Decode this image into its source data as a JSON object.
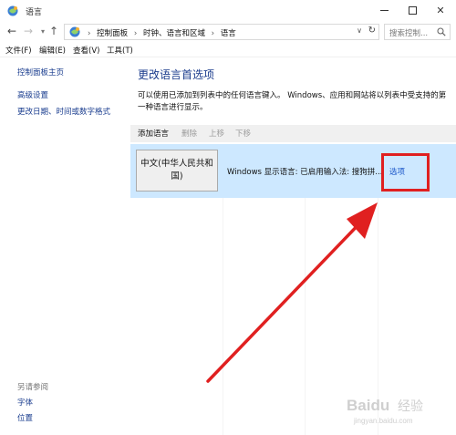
{
  "window": {
    "title": "语言",
    "minimize": "minimize",
    "maximize": "maximize",
    "close": "✕"
  },
  "address_bar": {
    "breadcrumbs": [
      "控制面板",
      "时钟、语言和区域",
      "语言"
    ],
    "search_placeholder": "搜索控制..."
  },
  "menu": {
    "items": [
      "文件(F)",
      "编辑(E)",
      "查看(V)",
      "工具(T)"
    ]
  },
  "sidebar": {
    "home": "控制面板主页",
    "advanced": "高级设置",
    "change_date": "更改日期、时间或数字格式",
    "see_also_heading": "另请参阅",
    "see_also": [
      "字体",
      "位置"
    ]
  },
  "main": {
    "title": "更改语言首选项",
    "description": "可以使用已添加到列表中的任何语言键入。 Windows、应用和网站将以列表中受支持的第一种语言进行显示。",
    "toolbar": {
      "add": "添加语言",
      "remove": "删除",
      "move_up": "上移",
      "move_down": "下移"
    },
    "languages": [
      {
        "name": "中文(中华人民共和国)",
        "info": "Windows 显示语言: 已启用输入法: 搜狗拼...",
        "options": "选项"
      }
    ]
  },
  "colors": {
    "selected_row": "#cde8ff",
    "link": "#1a3d8f",
    "title": "#1a3b8c",
    "annotation": "#e02020"
  },
  "watermark": {
    "text": "Baidu 经验",
    "url": "jingyan.baidu.com"
  }
}
